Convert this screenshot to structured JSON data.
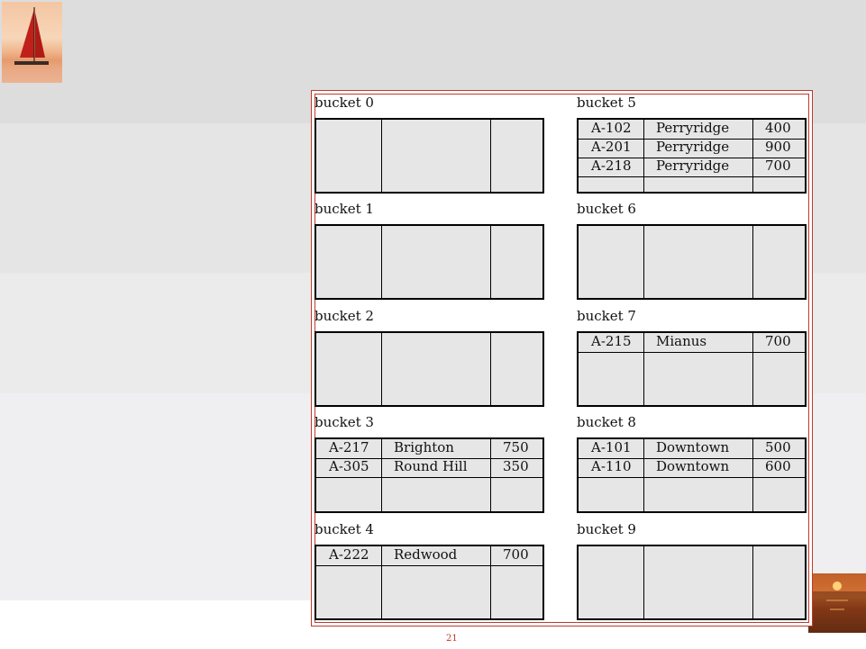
{
  "footer": {
    "page_number": "21"
  },
  "buckets": [
    {
      "label": "bucket 0",
      "rows": []
    },
    {
      "label": "bucket 1",
      "rows": []
    },
    {
      "label": "bucket 2",
      "rows": []
    },
    {
      "label": "bucket 3",
      "rows": [
        [
          "A-217",
          "Brighton",
          "750"
        ],
        [
          "A-305",
          "Round Hill",
          "350"
        ]
      ]
    },
    {
      "label": "bucket 4",
      "rows": [
        [
          "A-222",
          "Redwood",
          "700"
        ]
      ]
    },
    {
      "label": "bucket 5",
      "rows": [
        [
          "A-102",
          "Perryridge",
          "400"
        ],
        [
          "A-201",
          "Perryridge",
          "900"
        ],
        [
          "A-218",
          "Perryridge",
          "700"
        ]
      ]
    },
    {
      "label": "bucket 6",
      "rows": []
    },
    {
      "label": "bucket 7",
      "rows": [
        [
          "A-215",
          "Mianus",
          "700"
        ]
      ]
    },
    {
      "label": "bucket 8",
      "rows": [
        [
          "A-101",
          "Downtown",
          "500"
        ],
        [
          "A-110",
          "Downtown",
          "600"
        ]
      ]
    },
    {
      "label": "bucket 9",
      "rows": []
    }
  ]
}
